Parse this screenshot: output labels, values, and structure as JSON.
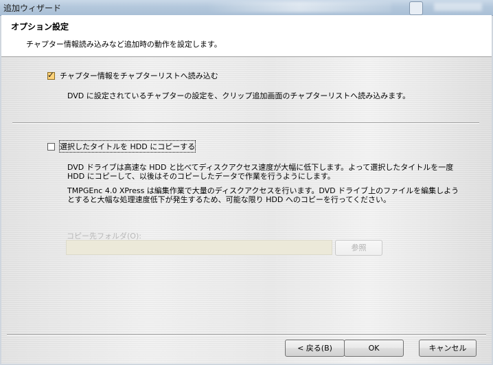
{
  "window": {
    "title": "追加ウィザード"
  },
  "header": {
    "title": "オプション設定",
    "description": "チャプター情報読み込みなど追加時の動作を設定します。"
  },
  "options": {
    "chapter": {
      "label": "チャプター情報をチャプターリストへ読み込む",
      "checked": true,
      "description": "DVD に設定されているチャプターの設定を、クリップ追加画面のチャプターリストへ読み込みます。"
    },
    "copy": {
      "label": "選択したタイトルを HDD にコピーする",
      "checked": false,
      "description_1": "DVD ドライブは高速な HDD と比べてディスクアクセス速度が大幅に低下します。よって選択したタイトルを一度",
      "description_2": "HDD にコピーして、以後はそのコピーしたデータで作業を行うようにします。",
      "description_3": "TMPGEnc 4.0 XPress は編集作業で大量のディスクアクセスを行います。DVD ドライブ上のファイルを編集しよう",
      "description_4": "とすると大幅な処理速度低下が発生するため、可能な限り HDD へのコピーを行ってください。"
    }
  },
  "copy_folder": {
    "label": "コピー先フォルダ(O):",
    "value": "",
    "browse_label": "参照"
  },
  "footer": {
    "back_label": "< 戻る(B)",
    "ok_label": "OK",
    "cancel_label": "キャンセル"
  }
}
